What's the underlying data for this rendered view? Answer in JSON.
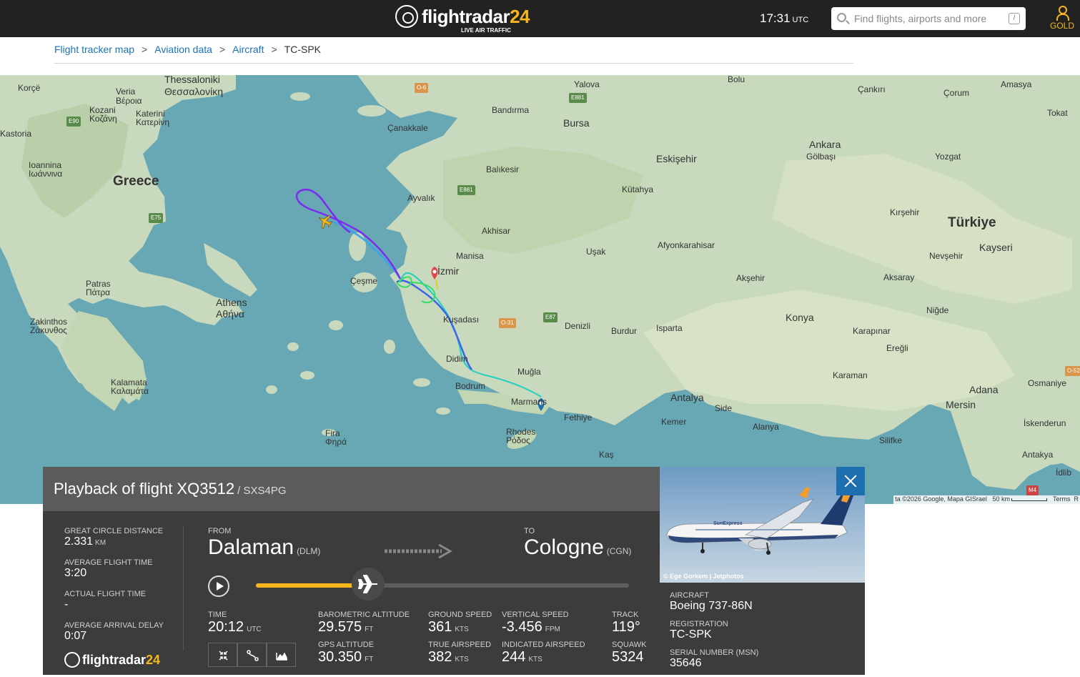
{
  "header": {
    "logo_name": "flightradar",
    "logo_num": "24",
    "logo_sub": "LIVE AIR TRAFFIC",
    "time": "17:31",
    "time_zone": "UTC",
    "search_placeholder": "Find flights, airports and more",
    "search_shortcut": "/",
    "account_label": "GOLD"
  },
  "breadcrumb": {
    "items": [
      "Flight tracker map",
      "Aviation data",
      "Aircraft"
    ],
    "separator": ">",
    "current": "TC-SPK"
  },
  "map": {
    "labels": [
      "Thessaloniki",
      "Θεσσαλονίκη",
      "Veria",
      "Βέροια",
      "Kozani",
      "Κοζάνη",
      "Katerini",
      "Κατερίνη",
      "Korçë",
      "Kastoria",
      "Ioannina",
      "Ιωάννινα",
      "Greece",
      "Patras",
      "Πάτρα",
      "Athens",
      "Αθήνα",
      "Zakinthos",
      "Ζάκυνθος",
      "Kalamata",
      "Καλαμάτα",
      "Fira",
      "Φηρά",
      "Rhodes",
      "Ρόδος",
      "Bandırma",
      "Bursa",
      "Çanakkale",
      "Balıkesir",
      "Ayvalık",
      "Akhisar",
      "Manisa",
      "İzmir",
      "Çeşme",
      "Kuşadası",
      "Didim",
      "Bodrum",
      "Muğla",
      "Marmaris",
      "Fethiye",
      "Kaş",
      "Denizli",
      "Burdur",
      "Isparta",
      "Uşak",
      "Afyonkarahisar",
      "Kütahya",
      "Eskişehir",
      "Ankara",
      "Gölbaşı",
      "Bolu",
      "Çankırı",
      "Çorum",
      "Amasya",
      "Tokat",
      "Yozgat",
      "Kırşehir",
      "Türkiye",
      "Kayseri",
      "Nevşehir",
      "Aksaray",
      "Niğde",
      "Konya",
      "Akşehir",
      "Karapınar",
      "Ereğli",
      "Karaman",
      "Antalya",
      "Side",
      "Kemer",
      "Alanya",
      "Mersin",
      "Adana",
      "Osmaniye",
      "Silifke",
      "İskenderun",
      "Antakya",
      "İdlib",
      "Yalova"
    ],
    "road_badges": [
      "E90",
      "E75",
      "O-6",
      "E881",
      "E881",
      "E87",
      "O-31",
      "M4",
      "O-52"
    ],
    "attribution": "ta ©2026 Google, Mapa GISrael",
    "scale_label": "50 km",
    "terms": "Terms",
    "cut_text": "R",
    "track_colors": [
      "#7b2cf0",
      "#3c64e8",
      "#3aa4e8",
      "#20d0c0",
      "#30e060",
      "#e0d020"
    ]
  },
  "playback": {
    "title": "Playback of flight XQ3512",
    "callsign": "/ SXS4PG",
    "great_circle_label": "GREAT CIRCLE DISTANCE",
    "great_circle_value": "2.331",
    "great_circle_unit": "KM",
    "avg_flight_time_label": "AVERAGE FLIGHT TIME",
    "avg_flight_time_value": "3:20",
    "actual_flight_time_label": "ACTUAL FLIGHT TIME",
    "actual_flight_time_value": "-",
    "avg_delay_label": "AVERAGE ARRIVAL DELAY",
    "avg_delay_value": "0:07",
    "from_label": "FROM",
    "from_city": "Dalaman",
    "from_code": "(DLM)",
    "to_label": "TO",
    "to_city": "Cologne",
    "to_code": "(CGN)",
    "progress": 0.3,
    "time_label": "TIME",
    "time_value": "20:12",
    "time_unit": "UTC",
    "baro_alt_label": "BAROMETRIC ALTITUDE",
    "baro_alt_value": "29.575",
    "baro_alt_unit": "FT",
    "gps_alt_label": "GPS ALTITUDE",
    "gps_alt_value": "30.350",
    "gps_alt_unit": "FT",
    "ground_speed_label": "GROUND SPEED",
    "ground_speed_value": "361",
    "ground_speed_unit": "KTS",
    "true_airspeed_label": "TRUE AIRSPEED",
    "true_airspeed_value": "382",
    "true_airspeed_unit": "KTS",
    "vertical_speed_label": "VERTICAL SPEED",
    "vertical_speed_value": "-3.456",
    "vertical_speed_unit": "FPM",
    "indicated_airspeed_label": "INDICATED AIRSPEED",
    "indicated_airspeed_value": "244",
    "indicated_airspeed_unit": "KTS",
    "track_label": "TRACK",
    "track_value": "119°",
    "squawk_label": "SQUAWK",
    "squawk_value": "5324",
    "footer_logo_name": "flightradar",
    "footer_logo_num": "24"
  },
  "aircraft": {
    "photo_credit": "© Ege Gorkem | Jetphotos",
    "aircraft_label": "AIRCRAFT",
    "aircraft_value": "Boeing 737-86N",
    "registration_label": "REGISTRATION",
    "registration_value": "TC-SPK",
    "serial_label": "SERIAL NUMBER (MSN)",
    "serial_value": "35646",
    "livery_text": "SunExpress"
  }
}
